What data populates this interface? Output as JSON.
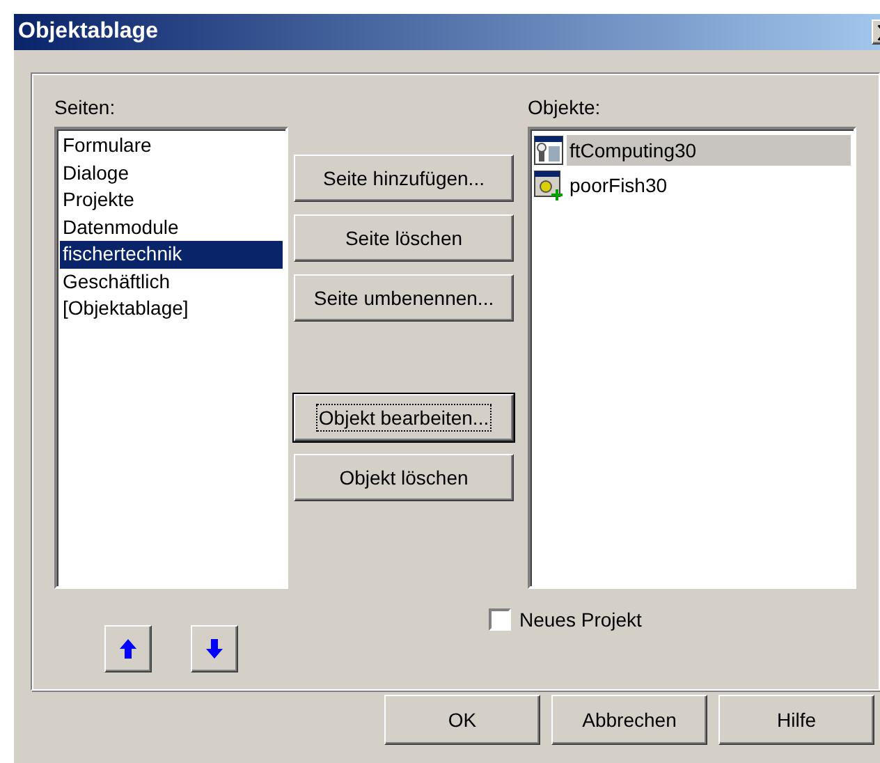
{
  "window": {
    "title": "Objektablage"
  },
  "pages": {
    "label": "Seiten:",
    "items": [
      {
        "label": "Formulare",
        "selected": false
      },
      {
        "label": "Dialoge",
        "selected": false
      },
      {
        "label": "Projekte",
        "selected": false
      },
      {
        "label": "Datenmodule",
        "selected": false
      },
      {
        "label": "fischertechnik",
        "selected": true
      },
      {
        "label": "Geschäftlich",
        "selected": false
      },
      {
        "label": "[Objektablage]",
        "selected": false
      }
    ]
  },
  "actions": [
    {
      "label": "Seite hinzufügen...",
      "default": false
    },
    {
      "label": "Seite löschen",
      "default": false
    },
    {
      "label": "Seite umbenennen...",
      "default": false
    },
    {
      "label": "Objekt bearbeiten...",
      "default": true
    },
    {
      "label": "Objekt löschen",
      "default": false
    }
  ],
  "objects": {
    "label": "Objekte:",
    "items": [
      {
        "label": "ftComputing30",
        "selected": true,
        "kind": "form"
      },
      {
        "label": "poorFish30",
        "selected": false,
        "kind": "project"
      }
    ]
  },
  "new_project": {
    "label": "Neues Projekt",
    "checked": false
  },
  "buttons": [
    "OK",
    "Abbrechen",
    "Hilfe"
  ]
}
